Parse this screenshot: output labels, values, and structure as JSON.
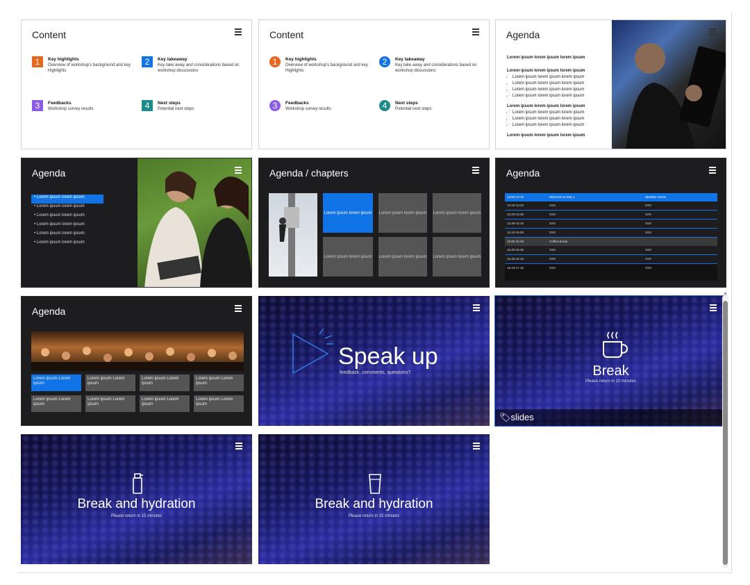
{
  "slides": {
    "s1": {
      "title": "Content",
      "items": [
        {
          "num": "1",
          "head": "Key highlights",
          "body": "Overview of workshop's background and key Highlights",
          "color": "#e8661f"
        },
        {
          "num": "2",
          "head": "Key takeaway",
          "body": "Key take away and considerations based on workshop discussions",
          "color": "#1174e6"
        },
        {
          "num": "3",
          "head": "Feedbacks",
          "body": "Workshop survey results",
          "color": "#8b5ce6"
        },
        {
          "num": "4",
          "head": "Next steps",
          "body": "Potential next steps",
          "color": "#1f8a8a"
        }
      ]
    },
    "s2": {
      "title": "Content",
      "items": [
        {
          "num": "1",
          "head": "Key highlights",
          "body": "Overview of workshop's background and key Highlights",
          "color": "#e8661f"
        },
        {
          "num": "2",
          "head": "Key takeaway",
          "body": "Key take away and considerations based on workshop discussions",
          "color": "#1174e6"
        },
        {
          "num": "3",
          "head": "Feedbacks",
          "body": "Workshop survey results",
          "color": "#8b5ce6"
        },
        {
          "num": "4",
          "head": "Next steps",
          "body": "Potential next steps",
          "color": "#1f8a8a"
        }
      ]
    },
    "s3": {
      "title": "Agenda",
      "bold": "Lorem ipsum lorem ipsum lorem ipsum",
      "bullet": "Lorem ipsum lorem ipsum lorem ipsum"
    },
    "s4": {
      "title": "Agenda",
      "item": "Lorem ipsum lorem ipsum"
    },
    "s5": {
      "title": "Agenda / chapters",
      "tile": "Lorem ipsum lorem ipsum"
    },
    "s6": {
      "title": "Agenda",
      "rows": [
        [
          "13:00-13.10",
          "Welcome to Day 1",
          "Speaker Name"
        ],
        [
          "13.10-13.20",
          "XXX",
          "XXX"
        ],
        [
          "13.20-13.45",
          "XXX",
          "XXX"
        ],
        [
          "13.45-14.10",
          "XXX",
          "XXX"
        ],
        [
          "14.10-15.00",
          "XXX",
          "XXX"
        ],
        [
          "15.00-15.20",
          "Coffee Break",
          ""
        ],
        [
          "15.20-15.45",
          "XXX",
          "XXX"
        ],
        [
          "15.45-16.10",
          "XXX",
          "XXX"
        ],
        [
          "16.10-17.10",
          "XXX",
          "XXX"
        ]
      ]
    },
    "s7": {
      "title": "Agenda",
      "tile": "Lorem ipsum Lorem ipsum"
    },
    "s8": {
      "title": "Speak up",
      "sub": "feedback, comments, questions?"
    },
    "s9": {
      "title": "Break",
      "sub": "Please return in 10 minutes",
      "caption": "slides"
    },
    "s10": {
      "title": "Break and hydration",
      "sub": "Please return in 15 minutes"
    },
    "s11": {
      "title": "Break and hydration",
      "sub": "Please return in 15 minutes"
    }
  },
  "colors": {
    "accent": "#1174e6",
    "dark": "#1d1d1f",
    "tile": "#555555"
  }
}
